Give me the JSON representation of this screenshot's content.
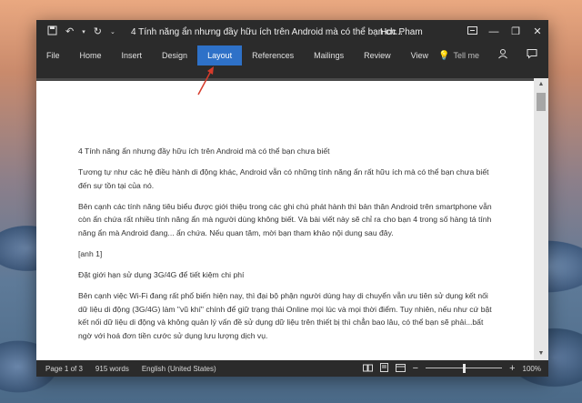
{
  "titlebar": {
    "doc_title": "4 Tính năng ẩn nhưng đầy hữu ích trên Android mà có thể bạn ch...",
    "user": "Hoc Pham"
  },
  "ribbon": {
    "tabs": [
      "File",
      "Home",
      "Insert",
      "Design",
      "Layout",
      "References",
      "Mailings",
      "Review",
      "View"
    ],
    "active_tab": "Layout",
    "tell_me": "Tell me"
  },
  "document": {
    "paragraphs": [
      "4 Tính năng ẩn nhưng đầy hữu ích trên Android mà có thể bạn chưa biết",
      "Tương tự như các hệ điều hành di động khác, Android vẫn có những tính năng ẩn rất hữu ích mà có thể bạn chưa biết đến sự tồn tại của nó.",
      "Bên cạnh các tính năng tiêu biểu được giới thiệu trong các ghi chú phát hành thì bản thân Android trên smartphone vẫn còn ẩn chứa rất nhiều tính năng ẩn mà người dùng không biết. Và bài viết này sẽ chỉ ra cho bạn 4 trong số hàng tá tính năng ẩn mà Android đang... ẩn chứa. Nếu quan tâm, mời bạn tham khảo nội dung sau đây.",
      "[anh 1]",
      "Đặt giới hạn sử dụng 3G/4G để tiết kiệm chi phí",
      "Bên cạnh việc Wi-Fi đang rất phổ biến hiện nay, thì đại bộ phận người dùng hay di chuyển vẫn ưu tiên sử dụng kết nối dữ liệu di động (3G/4G) làm \"vũ khí\" chính để giữ trạng thái Online mọi lúc và mọi thời điểm. Tuy nhiên, nếu như cứ bật kết nối dữ liệu di động và không quản lý vấn đề sử dụng dữ liệu trên thiết bị thì chẳn bao lâu, có thể bạn sẽ phải...bất ngờ với hoá đơn tiền cước sử dụng lưu lượng dịch vụ."
    ]
  },
  "statusbar": {
    "page": "Page 1 of 3",
    "words": "915 words",
    "language": "English (United States)",
    "zoom": "100%",
    "zoom_minus": "−",
    "zoom_plus": "+"
  },
  "icons": {
    "save": "save-icon",
    "undo": "undo-icon",
    "redo": "redo-icon",
    "customize": "chevron-down-icon",
    "ribbon_display": "ribbon-display-icon",
    "minimize": "minimize-icon",
    "restore": "restore-icon",
    "close": "close-icon",
    "tell_me": "lightbulb-icon",
    "share": "share-icon",
    "comments": "comment-icon"
  },
  "colors": {
    "active_tab": "#2e71c8",
    "window_chrome": "#2b2b2b",
    "annotation_arrow": "#d63b2b"
  }
}
